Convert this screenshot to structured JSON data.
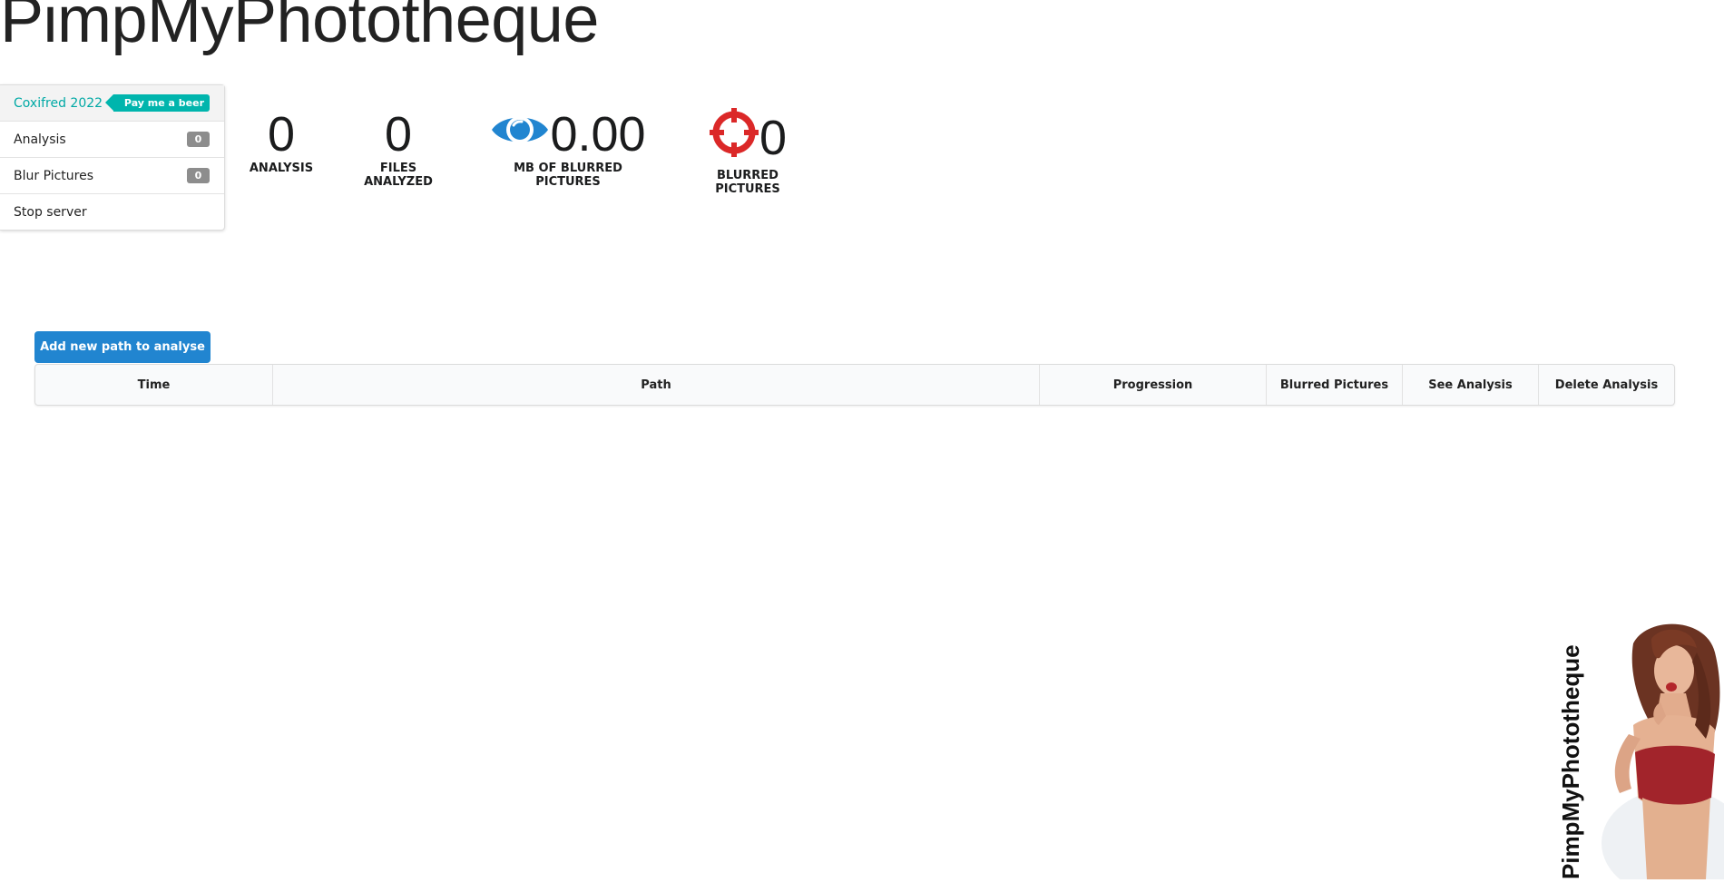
{
  "app": {
    "title": "PimpMyPhototheque"
  },
  "menu": {
    "items": [
      {
        "label": "Coxifred 2022",
        "ribbon": "Pay me a beer",
        "active": true
      },
      {
        "label": "Analysis",
        "badge": "0"
      },
      {
        "label": "Blur Pictures",
        "badge": "0"
      },
      {
        "label": "Stop server"
      }
    ]
  },
  "stats": [
    {
      "value": "0",
      "label": "ANALYSIS"
    },
    {
      "value": "0",
      "label": "FILES ANALYZED"
    },
    {
      "value": "0.00",
      "label": "MB OF BLURRED PICTURES",
      "icon": "eye-icon"
    },
    {
      "value": "0",
      "label": "BLURRED PICTURES",
      "icon": "target-icon"
    }
  ],
  "actions": {
    "add_path": "Add new path to analyse"
  },
  "table": {
    "columns": [
      "Time",
      "Path",
      "Progression",
      "Blurred Pictures",
      "See Analysis",
      "Delete Analysis"
    ],
    "rows": []
  },
  "mascot": {
    "caption": "PimpMyPhototheque"
  },
  "colors": {
    "accent": "#00b5ad",
    "primary": "#2185d0",
    "eye": "#2185d0",
    "target": "#db2828"
  }
}
